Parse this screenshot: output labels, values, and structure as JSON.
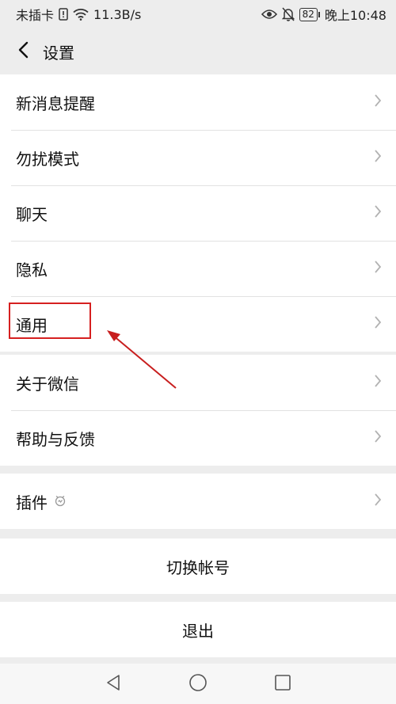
{
  "statusbar": {
    "carrier": "未插卡",
    "speed": "11.3B/s",
    "battery": "82",
    "time": "晚上10:48"
  },
  "header": {
    "title": "设置"
  },
  "group1": [
    {
      "label": "新消息提醒"
    },
    {
      "label": "勿扰模式"
    },
    {
      "label": "聊天"
    },
    {
      "label": "隐私"
    },
    {
      "label": "通用"
    }
  ],
  "group2": [
    {
      "label": "关于微信"
    },
    {
      "label": "帮助与反馈"
    }
  ],
  "group3": [
    {
      "label": "插件",
      "icon": "plugin-badge-icon"
    }
  ],
  "actions": {
    "switch_account": "切换帐号",
    "logout": "退出"
  },
  "colors": {
    "background": "#ededed",
    "highlight": "#d62020"
  }
}
